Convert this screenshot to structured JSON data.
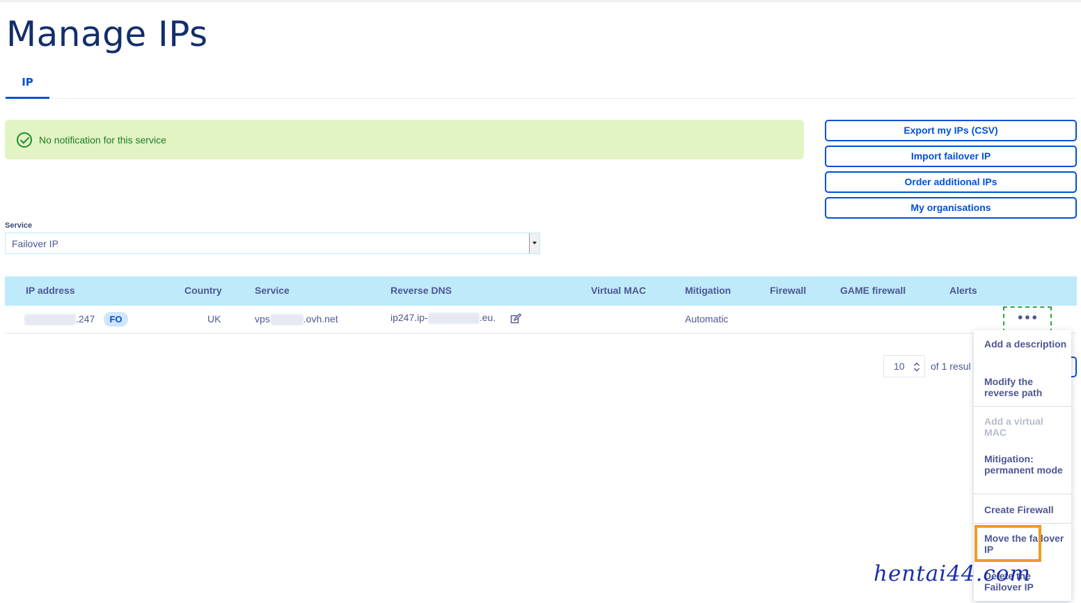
{
  "page": {
    "title": "Manage IPs"
  },
  "tabs": [
    {
      "label": "IP"
    }
  ],
  "notice": {
    "text": "No notification for this service"
  },
  "actions": {
    "export": "Export my IPs (CSV)",
    "import": "Import failover IP",
    "order": "Order additional IPs",
    "organisations": "My organisations"
  },
  "service": {
    "label": "Service",
    "value": "Failover IP"
  },
  "table": {
    "columns": [
      "IP address",
      "Country",
      "Service",
      "Reverse DNS",
      "Virtual MAC",
      "Mitigation",
      "Firewall",
      "GAME firewall",
      "Alerts"
    ],
    "row": {
      "ip_suffix": ".247",
      "badge": "FO",
      "country": "UK",
      "service_prefix": "vps",
      "service_suffix": ".ovh.net",
      "rdns_prefix": "ip247.ip-",
      "rdns_suffix": ".eu.",
      "mitigation": "Automatic",
      "more": "•••"
    }
  },
  "pagination": {
    "per_page": "10",
    "results_text": "of 1 resul"
  },
  "menu": {
    "add_description": "Add a description",
    "modify_reverse": "Modify the reverse path",
    "add_virtual_mac": "Add a virtual MAC",
    "mitigation_permanent": "Mitigation: permanent mode",
    "create_firewall": "Create Firewall",
    "move_failover": "Move the failover IP",
    "delete_failover": "Delete the Failover IP"
  },
  "watermark": "hentai44.com",
  "colors": {
    "accent": "#0050d7",
    "title": "#122e6b",
    "header_bg": "#bfeafa",
    "notice_bg": "#e2f3c4",
    "highlight": "#f39a1f"
  }
}
